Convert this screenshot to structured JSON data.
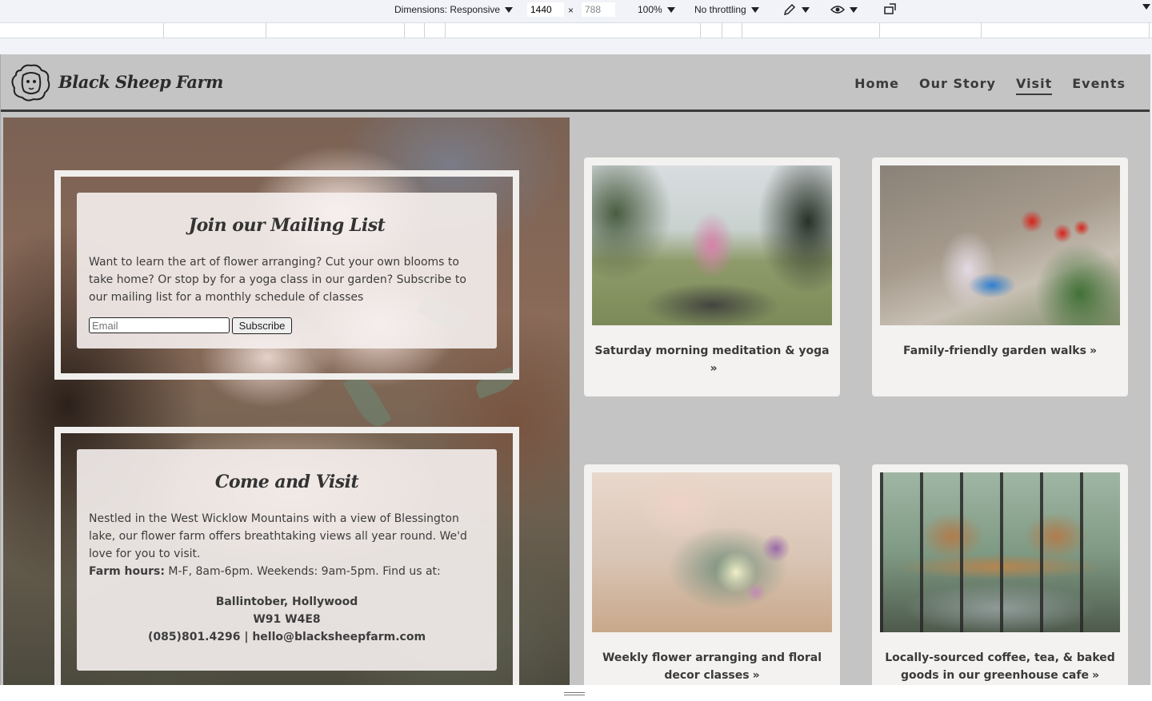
{
  "devtools": {
    "dimensions_label": "Dimensions: Responsive",
    "width": "1440",
    "times": "×",
    "height": "788",
    "zoom": "100%",
    "throttling": "No throttling"
  },
  "site": {
    "brand": "Black Sheep Farm",
    "nav": [
      "Home",
      "Our Story",
      "Visit",
      "Events"
    ],
    "active_nav": "Visit"
  },
  "mailing": {
    "title": "Join our Mailing List",
    "body": "Want to learn the art of flower arranging? Cut your own blooms to take home? Or stop by for a yoga class in our garden? Subscribe to our mailing list for a monthly schedule of classes",
    "email_placeholder": "Email",
    "subscribe_label": "Subscribe"
  },
  "visit": {
    "title": "Come and Visit",
    "body": "Nestled in the West Wicklow Mountains with a view of Blessington lake, our flower farm offers breathtaking views all year round. We'd love for you to visit.",
    "hours_label": "Farm hours:",
    "hours_text": " M-F, 8am-6pm. Weekends: 9am-5pm. Find us at:",
    "address_line1": "Ballintober, Hollywood",
    "address_line2": "W91 W4E8",
    "contact": "(085)801.4296 | hello@blacksheepfarm.com"
  },
  "activities": [
    {
      "label": "Saturday morning meditation & yoga",
      "icon": "double-chevron-right-icon"
    },
    {
      "label": "Family-friendly garden walks",
      "icon": "double-chevron-right-icon"
    },
    {
      "label": "Weekly flower arranging and floral decor classes",
      "icon": "double-chevron-right-icon"
    },
    {
      "label": "Locally-sourced coffee, tea, & baked goods in our greenhouse cafe",
      "icon": "double-chevron-right-icon"
    }
  ],
  "chevron_glyph": "»"
}
